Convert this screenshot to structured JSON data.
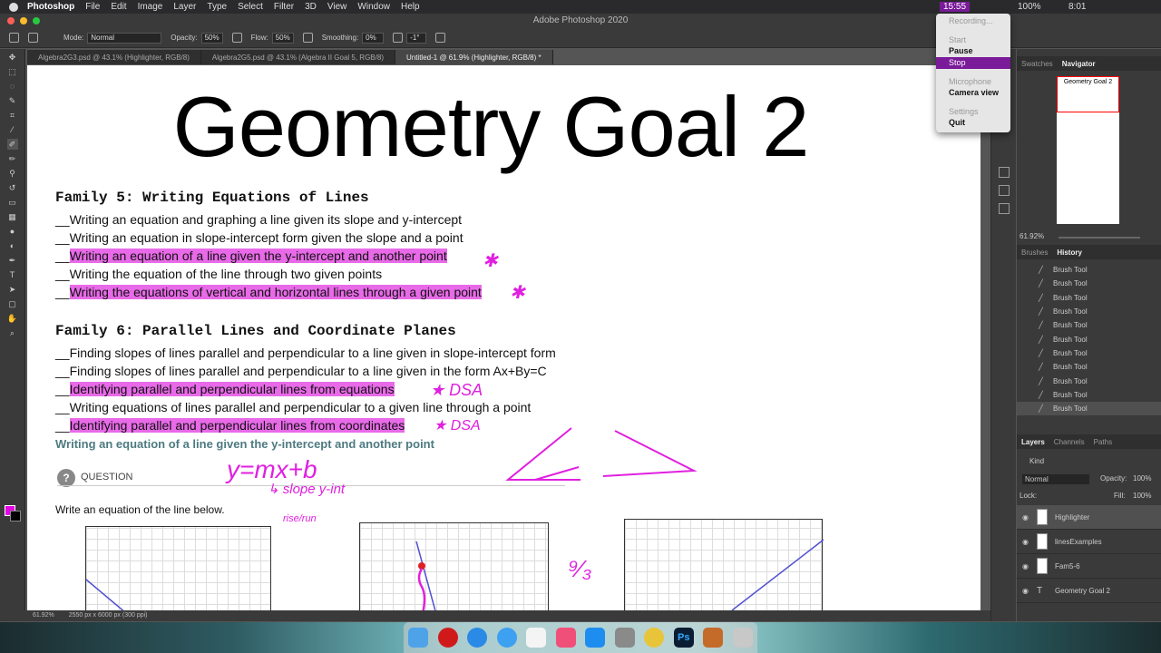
{
  "menubar": {
    "app": "Photoshop",
    "items": [
      "File",
      "Edit",
      "Image",
      "Layer",
      "Type",
      "Select",
      "Filter",
      "3D",
      "View",
      "Window",
      "Help"
    ],
    "time": "8:01",
    "rec_time": "15:55",
    "battery": "100%"
  },
  "window": {
    "title": "Adobe Photoshop 2020"
  },
  "options": {
    "mode_label": "Mode:",
    "mode": "Normal",
    "opacity_label": "Opacity:",
    "opacity": "50%",
    "flow_label": "Flow:",
    "flow": "50%",
    "smoothing_label": "Smoothing:",
    "smoothing": "0%",
    "angle": "-1°"
  },
  "tabs": [
    "Algebra2G3.psd @ 43.1% (Highlighter, RGB/8)",
    "Algebra2G5.psd @ 43.1% (Algebra II Goal 5, RGB/8)",
    "Untitled-1 @ 61.9% (Highlighter, RGB/8) *"
  ],
  "doc": {
    "title": "Geometry Goal 2",
    "fam5": "Family 5: Writing Equations of Lines",
    "fam5_items": [
      "__Writing an equation and graphing a line given its slope and y-intercept",
      "__Writing an equation in slope-intercept form given the slope and a point",
      "Writing an equation of a line given the y-intercept and another point",
      "__Writing the equation of the line through two given points",
      "Writing the equations of vertical and horizontal lines through a given point"
    ],
    "fam6": "Family 6: Parallel Lines and Coordinate Planes",
    "fam6_items": [
      "__Finding slopes of lines parallel and perpendicular to a line given in slope-intercept form",
      "__Finding slopes of lines parallel and perpendicular to a line given in the form Ax+By=C",
      "Identifying parallel and perpendicular lines from equations",
      "__Writing equations of lines parallel and perpendicular to a given line through a point",
      "Identifying parallel and perpendicular lines from coordinates"
    ],
    "underscore": "__",
    "subhead": "Writing an equation of a line given the y-intercept and another point",
    "question": "QUESTION",
    "prompt": "Write an equation of the line below.",
    "handwriting": {
      "eq": "y=mx+b",
      "slope": "↳ slope  y-int",
      "rise": "rise/run",
      "dsa": "★ DSA"
    }
  },
  "navigator": {
    "tabs": [
      "Swatches",
      "Navigator"
    ],
    "zoom": "61.92%",
    "thumb_title": "Geometry Goal 2"
  },
  "history": {
    "tabs": [
      "Brushes",
      "History"
    ],
    "items": [
      "Brush Tool",
      "Brush Tool",
      "Brush Tool",
      "Brush Tool",
      "Brush Tool",
      "Brush Tool",
      "Brush Tool",
      "Brush Tool",
      "Brush Tool",
      "Brush Tool",
      "Brush Tool"
    ]
  },
  "layers": {
    "tabs": [
      "Layers",
      "Channels",
      "Paths"
    ],
    "kind": "Kind",
    "blend": "Normal",
    "opacity_label": "Opacity:",
    "opacity": "100%",
    "lock_label": "Lock:",
    "fill_label": "Fill:",
    "fill": "100%",
    "items": [
      "Highlighter",
      "linesExamples",
      "Fam5-6",
      "Geometry Goal 2"
    ]
  },
  "status": {
    "zoom": "61.92%",
    "info": "2550 px x 6000 px (300 ppi)"
  },
  "rec_menu": {
    "items": [
      "Recording...",
      "Start",
      "Pause",
      "Stop",
      "Microphone",
      "Camera view",
      "Settings",
      "Quit"
    ]
  },
  "colors": {
    "highlight": "#e86ae8",
    "ink": "#e020e0",
    "foreground": "#e600e6"
  }
}
